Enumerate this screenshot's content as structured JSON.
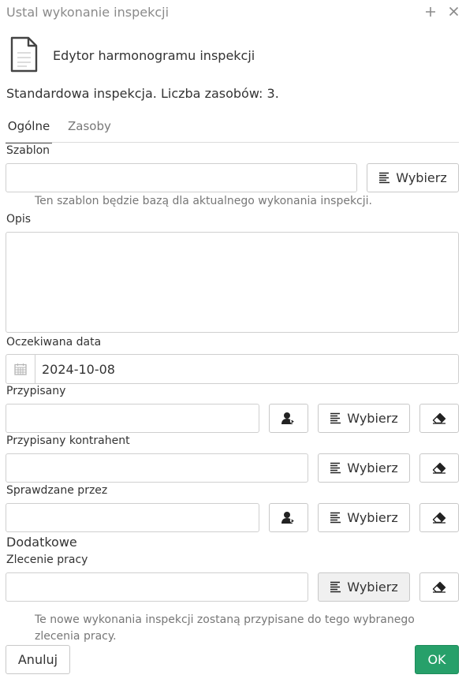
{
  "window": {
    "title": "Ustal wykonanie inspekcji",
    "maximize_icon": "plus-icon",
    "close_icon": "close-icon"
  },
  "header": {
    "icon": "document-icon",
    "subtitle": "Edytor harmonogramu inspekcji"
  },
  "info_text": "Standardowa inspekcja. Liczba zasobów: 3.",
  "tabs": [
    {
      "label": "Ogólne",
      "active": true
    },
    {
      "label": "Zasoby",
      "active": false
    }
  ],
  "form": {
    "template": {
      "label": "Szablon",
      "value": "",
      "select_label": "Wybierz",
      "hint": "Ten szablon będzie bazą dla aktualnego wykonania inspekcji."
    },
    "description": {
      "label": "Opis",
      "value": ""
    },
    "expected_date": {
      "label": "Oczekiwana data",
      "value": "2024-10-08",
      "icon": "calendar-icon"
    },
    "assigned": {
      "label": "Przypisany",
      "value": "",
      "select_label": "Wybierz"
    },
    "assigned_contractor": {
      "label": "Przypisany kontrahent",
      "value": "",
      "select_label": "Wybierz"
    },
    "checked_by": {
      "label": "Sprawdzane przez",
      "value": "",
      "select_label": "Wybierz"
    },
    "additional_section": "Dodatkowe",
    "work_order": {
      "label": "Zlecenie pracy",
      "value": "",
      "select_label": "Wybierz",
      "hint": "Te nowe wykonania inspekcji zostaną przypisane do tego wybranego zlecenia pracy."
    }
  },
  "footer": {
    "cancel_label": "Anuluj",
    "ok_label": "OK",
    "ok_color": "#27a06a"
  }
}
